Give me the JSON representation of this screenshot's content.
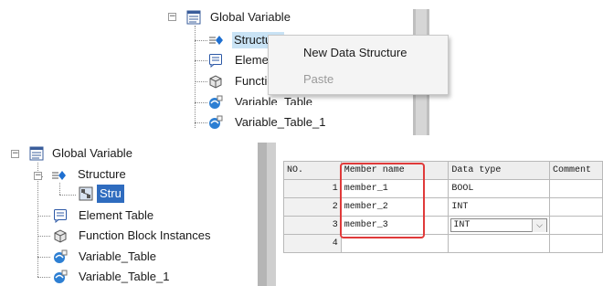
{
  "top_tree": {
    "root_label": "Global Variable",
    "items": [
      {
        "label": "Structure",
        "icon": "structure-icon"
      },
      {
        "label": "Element Table",
        "icon": "element-table-icon"
      },
      {
        "label": "Function Block Instances",
        "icon": "function-block-icon"
      },
      {
        "label": "Variable_Table",
        "icon": "variable-table-icon"
      },
      {
        "label": "Variable_Table_1",
        "icon": "variable-table-icon"
      }
    ]
  },
  "context_menu": {
    "items": [
      {
        "label": "New Data Structure",
        "enabled": true
      },
      {
        "label": "Paste",
        "enabled": false
      }
    ]
  },
  "bottom_tree": {
    "root_label": "Global Variable",
    "structure_label": "Structure",
    "child_label": "Stru",
    "items": [
      {
        "label": "Element Table",
        "icon": "element-table-icon"
      },
      {
        "label": "Function Block Instances",
        "icon": "function-block-icon"
      },
      {
        "label": "Variable_Table",
        "icon": "variable-table-icon"
      },
      {
        "label": "Variable_Table_1",
        "icon": "variable-table-icon"
      }
    ]
  },
  "member_table": {
    "columns": [
      "NO.",
      "Member name",
      "Data type",
      "Comment"
    ],
    "rows": [
      {
        "no": "1",
        "name": "member_1",
        "type": "BOOL",
        "comment": ""
      },
      {
        "no": "2",
        "name": "member_2",
        "type": "INT",
        "comment": ""
      },
      {
        "no": "3",
        "name": "member_3",
        "type": "INT",
        "comment": ""
      },
      {
        "no": "4",
        "name": "",
        "type": "",
        "comment": ""
      }
    ],
    "highlight_color": "#e03a3a"
  },
  "colors": {
    "selection": "#2f6cbf",
    "highlight": "#e03a3a"
  }
}
